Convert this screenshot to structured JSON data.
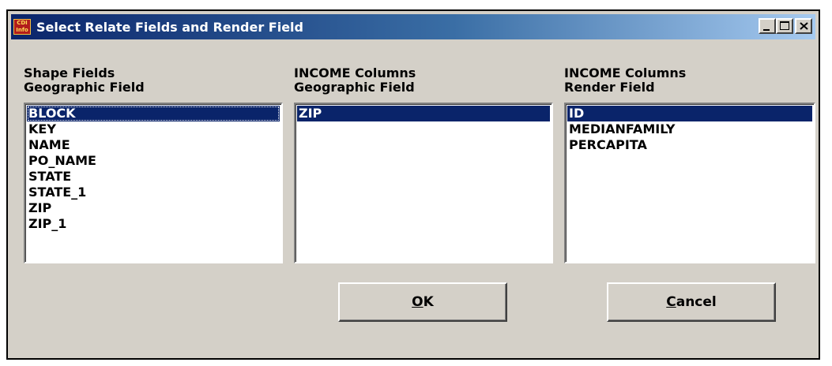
{
  "window": {
    "title": "Select Relate Fields and Render Field",
    "app_icon_text": "CDI Info"
  },
  "columns": [
    {
      "label_line1": "Shape Fields",
      "label_line2": "Geographic Field",
      "items": [
        "BLOCK",
        "KEY",
        "NAME",
        "PO_NAME",
        "STATE",
        "STATE_1",
        "ZIP",
        "ZIP_1"
      ],
      "selected": "BLOCK"
    },
    {
      "label_line1": "INCOME Columns",
      "label_line2": "Geographic Field",
      "items": [
        "ZIP"
      ],
      "selected": "ZIP"
    },
    {
      "label_line1": "INCOME Columns",
      "label_line2": "Render Field",
      "items": [
        "ID",
        "MEDIANFAMILY",
        "PERCAPITA"
      ],
      "selected": "ID"
    }
  ],
  "buttons": {
    "ok": {
      "mnemonic": "O",
      "rest": "K"
    },
    "cancel": {
      "mnemonic": "C",
      "rest": "ancel"
    }
  },
  "colors": {
    "selection": "#0a246a",
    "dialog_face": "#d4d0c8"
  }
}
